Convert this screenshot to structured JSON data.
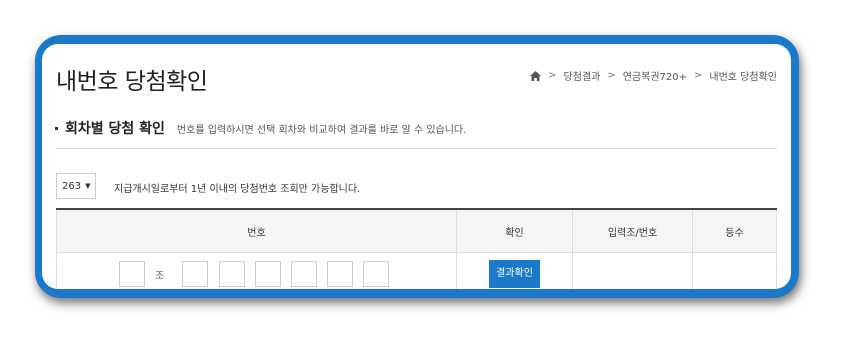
{
  "page": {
    "title": "내번호 당첨확인"
  },
  "breadcrumb": {
    "items": [
      "당첨결과",
      "연금복권720+",
      "내번호 당첨확인"
    ]
  },
  "section": {
    "title": "회차별 당첨 확인",
    "description": "번호를 입력하시면 선택 회차와 비교하여 결과를 바로 알 수 있습니다."
  },
  "round_select": {
    "value": "263"
  },
  "note": "지급개시일로부터 1년 이내의 당첨번호 조회만 가능합니다.",
  "table": {
    "headers": [
      "번호",
      "확인",
      "입력조/번호",
      "등수"
    ],
    "jo_label": "조",
    "check_button": "결과확인"
  },
  "colors": {
    "accent": "#1a7ac9"
  }
}
